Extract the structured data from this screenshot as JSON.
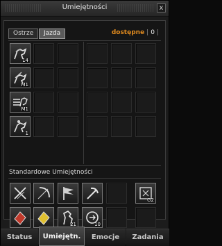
{
  "window": {
    "title": "Umiejętności",
    "close_label": "x"
  },
  "tabs": [
    {
      "label": "Ostrze"
    },
    {
      "label": "Jazda"
    }
  ],
  "available": {
    "label": "dostępne",
    "value": "0"
  },
  "skills": [
    {
      "icon": "horse-rider-icon",
      "level": "14"
    },
    {
      "icon": "horse-rider-icon",
      "level": "M1"
    },
    {
      "icon": "horse-arrow-icon",
      "level": "M1"
    },
    {
      "icon": "horse-rider-icon",
      "level": "1"
    }
  ],
  "standard": {
    "title": "Standardowe Umiejętności",
    "items": [
      {
        "icon": "swords-icon",
        "level": ""
      },
      {
        "icon": "bow-icon",
        "level": ""
      },
      {
        "icon": "flag-icon",
        "level": ""
      },
      {
        "icon": "pickaxe-icon",
        "level": ""
      },
      {
        "icon": "empty",
        "level": ""
      },
      {
        "icon": "rune-icon",
        "level": "G2"
      },
      {
        "icon": "red-book-icon",
        "level": ""
      },
      {
        "icon": "yellow-book-icon",
        "level": ""
      },
      {
        "icon": "horse-icon",
        "level": "21"
      },
      {
        "icon": "portal-icon",
        "level": "10"
      },
      {
        "icon": "empty",
        "level": ""
      },
      {
        "icon": "empty",
        "level": ""
      }
    ]
  },
  "bottom_tabs": [
    {
      "label": "Status"
    },
    {
      "label": "Umiejętn."
    },
    {
      "label": "Emocje"
    },
    {
      "label": "Zadania"
    }
  ]
}
